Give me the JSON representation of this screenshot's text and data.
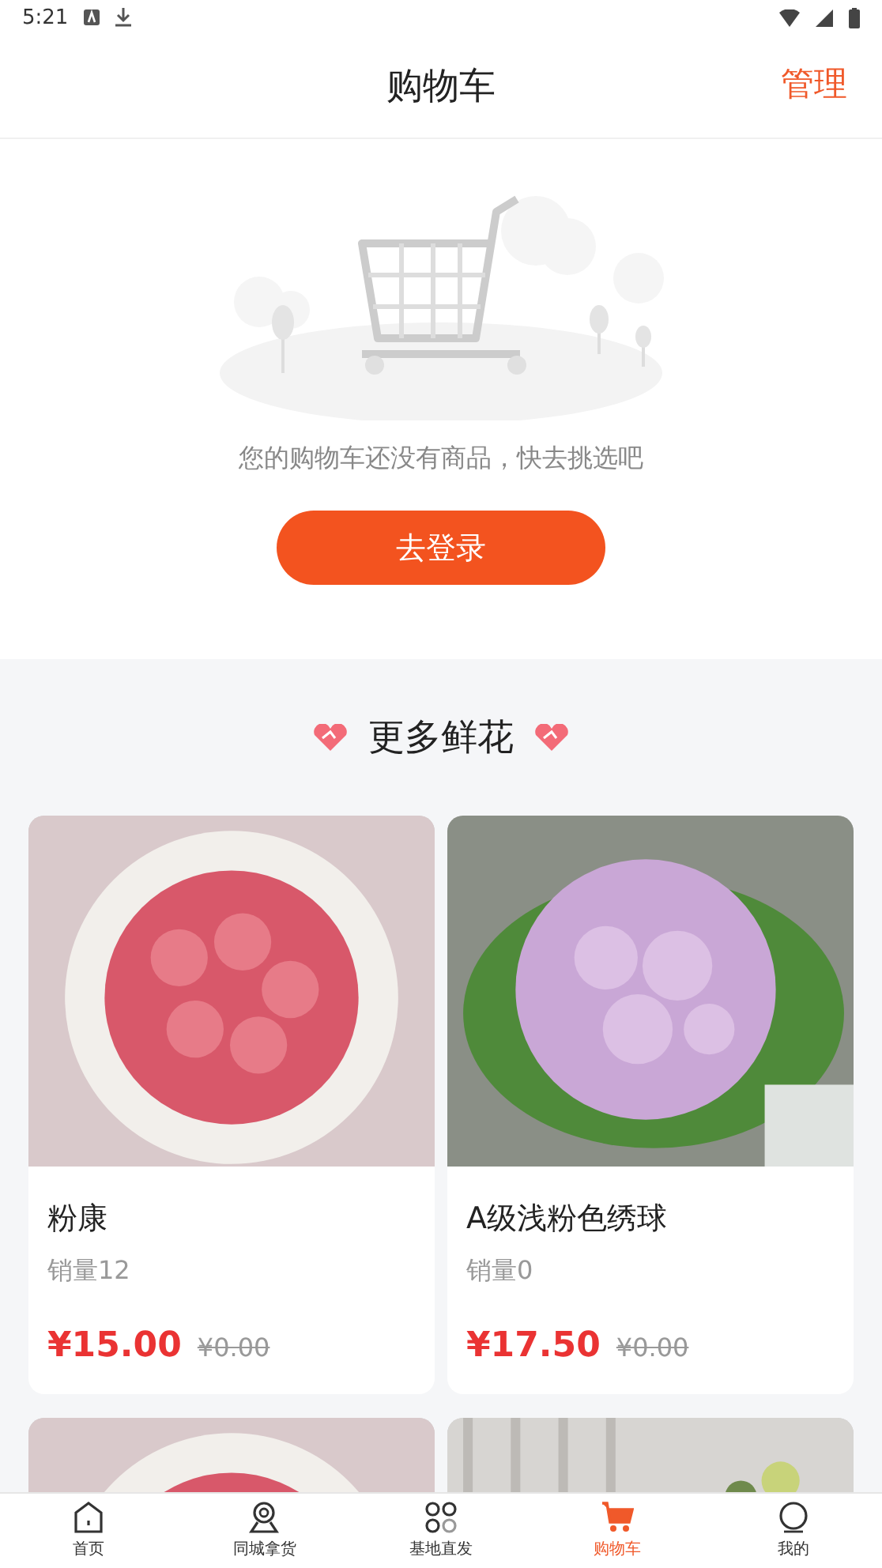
{
  "status_bar": {
    "time": "5:21"
  },
  "header": {
    "title": "购物车",
    "action": "管理"
  },
  "empty_cart": {
    "message": "您的购物车还没有商品，快去挑选吧",
    "button": "去登录"
  },
  "recommend": {
    "title": "更多鲜花",
    "products": [
      {
        "kind": "full",
        "name": "粉康",
        "sales": "销量12",
        "price": "¥15.00",
        "original_price": "¥0.00"
      },
      {
        "kind": "full",
        "name": "A级浅粉色绣球",
        "sales": "销量0",
        "price": "¥17.50",
        "original_price": "¥0.00"
      },
      {
        "kind": "partial"
      },
      {
        "kind": "partial"
      }
    ]
  },
  "tab_bar": [
    {
      "label": "首页",
      "selected": false
    },
    {
      "label": "同城拿货",
      "selected": false
    },
    {
      "label": "基地直发",
      "selected": false
    },
    {
      "label": "购物车",
      "selected": true
    },
    {
      "label": "我的",
      "selected": false
    }
  ]
}
